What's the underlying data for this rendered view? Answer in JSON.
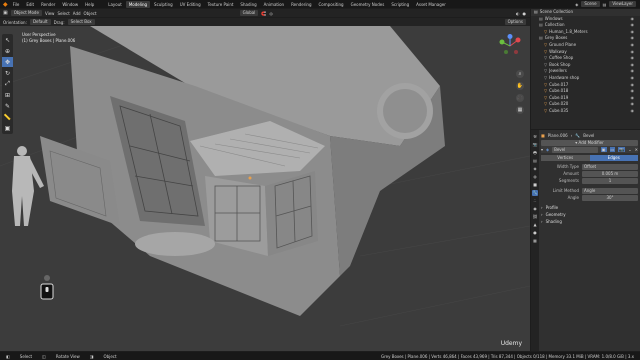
{
  "topbar": {
    "menus": [
      "File",
      "Edit",
      "Render",
      "Window",
      "Help"
    ],
    "workspaces": [
      {
        "label": "Layout",
        "active": false
      },
      {
        "label": "Modeling",
        "active": true
      },
      {
        "label": "Sculpting",
        "active": false
      },
      {
        "label": "UV Editing",
        "active": false
      },
      {
        "label": "Texture Paint",
        "active": false
      },
      {
        "label": "Shading",
        "active": false
      },
      {
        "label": "Animation",
        "active": false
      },
      {
        "label": "Rendering",
        "active": false
      },
      {
        "label": "Compositing",
        "active": false
      },
      {
        "label": "Geometry Nodes",
        "active": false
      },
      {
        "label": "Scripting",
        "active": false
      },
      {
        "label": "Asset Manager",
        "active": false
      }
    ],
    "scene": "Scene",
    "view_layer": "ViewLayer"
  },
  "viewport_header": {
    "mode": "Object Mode",
    "menus": [
      "View",
      "Select",
      "Add",
      "Object"
    ],
    "transform_orientation_label": "Orientation:",
    "transform_orientation": "Default",
    "drag_label": "Drag:",
    "drag_mode": "Select Box",
    "pivot": "Global",
    "options": "Options"
  },
  "viewport": {
    "view_name": "User Perspective",
    "object_info": "(1) Grey Boxes | Plane.006"
  },
  "outliner": {
    "title": "Scene Collection",
    "items": [
      {
        "label": "Windows",
        "indent": 1
      },
      {
        "label": "Collection",
        "indent": 1
      },
      {
        "label": "Human_1.8_Meters",
        "indent": 2
      },
      {
        "label": "Grey Boxes",
        "indent": 1
      },
      {
        "label": "Ground Plane",
        "indent": 2
      },
      {
        "label": "Walkway",
        "indent": 2
      },
      {
        "label": "Coffee Shop",
        "indent": 2
      },
      {
        "label": "Book Shop",
        "indent": 2
      },
      {
        "label": "Jewellers",
        "indent": 2
      },
      {
        "label": "Hardware shop",
        "indent": 2
      },
      {
        "label": "Cube.017",
        "indent": 2
      },
      {
        "label": "Cube.018",
        "indent": 2
      },
      {
        "label": "Cube.019",
        "indent": 2
      },
      {
        "label": "Cube.020",
        "indent": 2
      },
      {
        "label": "Cube.035",
        "indent": 2
      }
    ]
  },
  "properties": {
    "object_name": "Plane.006",
    "modifier_name": "Bevel",
    "add_modifier": "Add Modifier",
    "modifier_header": "Bevel",
    "affect_tabs": [
      {
        "label": "Vertices",
        "active": false
      },
      {
        "label": "Edges",
        "active": true
      }
    ],
    "fields": [
      {
        "label": "Width Type",
        "value": "Offset"
      },
      {
        "label": "Amount",
        "value": "0.005 m"
      },
      {
        "label": "Segments",
        "value": "1"
      },
      {
        "label": "Limit Method",
        "value": "Angle"
      },
      {
        "label": "Angle",
        "value": "30°"
      }
    ],
    "panels": [
      "Profile",
      "Geometry",
      "Shading"
    ]
  },
  "statusbar": {
    "items": [
      "Select",
      "Rotate View",
      "Object",
      "Grey Boxes | Plane.006 | Verts 46,864 | Faces 43,969 | Tris 87,344 | Objects 0/118 | Memory 33.1 MiB | VRAM: 1.0/8.0 GiB | 3.x"
    ]
  },
  "watermark": "Udemy",
  "colors": {
    "accent": "#4772b3",
    "outliner_bg": "#282828",
    "viewport_bg": "#3c3c3c"
  }
}
